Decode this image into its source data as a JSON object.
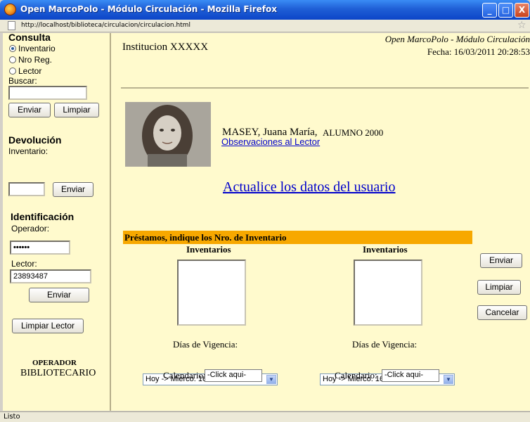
{
  "window": {
    "title": "Open MarcoPolo - Módulo Circulación - Mozilla Firefox",
    "url": "http://localhost/biblioteca/circulacion/circulacion.html",
    "status": "Listo",
    "buttons": {
      "minimize": "_",
      "maximize": "□",
      "close": "X"
    }
  },
  "sidebar": {
    "consulta": {
      "title": "Consulta",
      "options": [
        "Inventario",
        "Nro Reg.",
        "Lector"
      ],
      "selected": "Inventario",
      "buscar_label": "Buscar:",
      "buscar_value": "",
      "enviar": "Enviar",
      "limpiar": "Limpiar"
    },
    "devolucion": {
      "title": "Devolución",
      "inventario_label": "Inventario:",
      "inventario_value": "",
      "enviar": "Enviar"
    },
    "identificacion": {
      "title": "Identificación",
      "operador_label": "Operador:",
      "operador_value": "••••••",
      "lector_label": "Lector:",
      "lector_value": "23893487",
      "enviar": "Enviar",
      "limpiar_lector": "Limpiar Lector"
    },
    "operator_role": "OPERADOR",
    "operator_name": "BIBLIOTECARIO"
  },
  "header": {
    "institution": "Institucion XXXXX",
    "app_name": "Open MarcoPolo - Módulo Circulación",
    "fecha": "Fecha: 16/03/2011 20:28:53"
  },
  "reader": {
    "name": "MASEY, Juana María,",
    "category": "ALUMNO 2000",
    "observaciones_link": "Observaciones al Lector"
  },
  "update_link": "Actualice los datos del usuario",
  "prestamos": {
    "banner": "Préstamos, indique los Nro. de Inventario",
    "columns": [
      {
        "header": "Inventarios",
        "dias_label": "Días de Vigencia:",
        "dias_value": "Hoy -> Mierco. 16/03/2011",
        "calendario_label": "Calendario:",
        "calendario_button": "-Click aqui-"
      },
      {
        "header": "Inventarios",
        "dias_label": "Días de Vigencia:",
        "dias_value": "Hoy -> Mierco. 16/03/2011",
        "calendario_label": "Calendario:",
        "calendario_button": "-Click aqui-"
      }
    ],
    "actions": {
      "enviar": "Enviar",
      "limpiar": "Limpiar",
      "cancelar": "Cancelar"
    }
  },
  "colors": {
    "background": "#fffacd",
    "banner": "#f7a800",
    "link": "#0000cc",
    "titlebar": "#1f5fd6"
  }
}
